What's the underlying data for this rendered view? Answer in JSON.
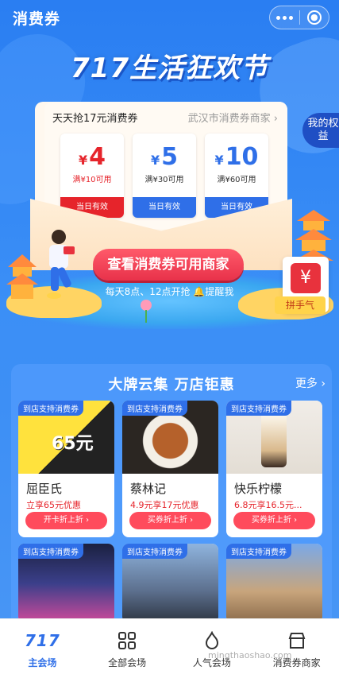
{
  "header": {
    "title": "消费券"
  },
  "festival": {
    "title": "717生活狂欢节"
  },
  "benefits": {
    "label": "我的权益"
  },
  "coupon_panel": {
    "heading": "天天抢17元消费券",
    "city": "武汉市消费券商家",
    "coupons": [
      {
        "amount": "4",
        "currency": "¥",
        "condition": "满¥10可用",
        "validity": "当日有效",
        "style": "red"
      },
      {
        "amount": "5",
        "currency": "¥",
        "condition": "满¥30可用",
        "validity": "当日有效",
        "style": "blue"
      },
      {
        "amount": "10",
        "currency": "¥",
        "condition": "满¥60可用",
        "validity": "当日有效",
        "style": "blue"
      }
    ]
  },
  "cta": {
    "label": "查看消费券可用商家"
  },
  "reminder": {
    "text": "每天8点、12点开抢",
    "link": "提醒我"
  },
  "red_envelope": {
    "label": "拼手气",
    "symbol": "¥"
  },
  "brand_section": {
    "title": "大牌云集 万店钜惠",
    "more": "更多",
    "cards": [
      {
        "badge": "到店支持消费券",
        "name": "屈臣氏",
        "deal": "立享65元优惠",
        "button": "开卡折上折",
        "img_text": "65元"
      },
      {
        "badge": "到店支持消费券",
        "name": "蔡林记",
        "deal": "4.9元享17元优惠",
        "button": "买券折上折"
      },
      {
        "badge": "到店支持消费券",
        "name": "快乐柠檬",
        "deal": "6.8元享16.5元...",
        "button": "买券折上折"
      },
      {
        "badge": "到店支持消费券"
      },
      {
        "badge": "到店支持消费券"
      },
      {
        "badge": "到店支持消费券"
      }
    ]
  },
  "tabbar": {
    "tabs": [
      {
        "label": "主会场",
        "active": true,
        "icon": "717-logo-icon"
      },
      {
        "label": "全部会场",
        "active": false,
        "icon": "grid-icon"
      },
      {
        "label": "人气会场",
        "active": false,
        "icon": "popular-icon"
      },
      {
        "label": "消费券商家",
        "active": false,
        "icon": "store-icon"
      }
    ],
    "logo_text": "717"
  },
  "watermark": "mingthaoshao.com"
}
